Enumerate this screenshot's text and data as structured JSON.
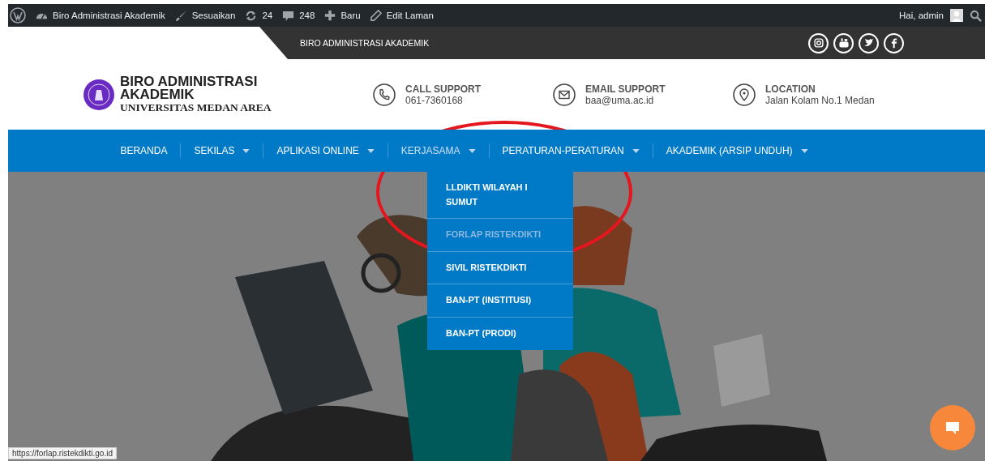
{
  "admin_bar": {
    "items": [
      {
        "kind": "site",
        "label": "Biro Administrasi Akademik"
      },
      {
        "kind": "customize",
        "label": "Sesuaikan"
      },
      {
        "kind": "updates",
        "label": "24"
      },
      {
        "kind": "comments",
        "label": "248"
      },
      {
        "kind": "new",
        "label": "Baru"
      },
      {
        "kind": "edit",
        "label": "Edit Laman"
      }
    ],
    "greeting": "Hai, admin"
  },
  "top_bar": {
    "title": "BIRO ADMINISTRASI AKADEMIK",
    "social": [
      {
        "kind": "instagram"
      },
      {
        "kind": "youtube"
      },
      {
        "kind": "twitter"
      },
      {
        "kind": "facebook"
      }
    ]
  },
  "header": {
    "logo_title": "BIRO ADMINISTRASI AKADEMIK",
    "logo_subtitle": "UNIVERSITAS MEDAN AREA",
    "contacts": [
      {
        "kind": "phone",
        "label": "CALL SUPPORT",
        "value": "061-7360168"
      },
      {
        "kind": "email",
        "label": "EMAIL SUPPORT",
        "value": "baa@uma.ac.id"
      },
      {
        "kind": "location",
        "label": "LOCATION",
        "value": "Jalan Kolam No.1 Medan"
      }
    ]
  },
  "nav": {
    "items": [
      {
        "label": "BERANDA",
        "dropdown": false,
        "selected": false
      },
      {
        "label": "SEKILAS",
        "dropdown": true,
        "selected": false
      },
      {
        "label": "APLIKASI ONLINE",
        "dropdown": true,
        "selected": false
      },
      {
        "label": "KERJASAMA",
        "dropdown": true,
        "selected": true
      },
      {
        "label": "PERATURAN-PERATURAN",
        "dropdown": true,
        "selected": false
      },
      {
        "label": "AKADEMIK (ARSIP UNDUH)",
        "dropdown": true,
        "selected": false
      }
    ],
    "submenu": [
      {
        "label": "LLDIKTI WILAYAH I SUMUT",
        "selected": false
      },
      {
        "label": "FORLAP RISTEKDIKTI",
        "selected": true
      },
      {
        "label": "SIVIL RISTEKDIKTI",
        "selected": false
      },
      {
        "label": "BAN-PT (INSTITUSI)",
        "selected": false
      },
      {
        "label": "BAN-PT (PRODI)",
        "selected": false
      }
    ]
  },
  "status_bar": {
    "url": "https://forlap.ristekdikti.go.id"
  }
}
